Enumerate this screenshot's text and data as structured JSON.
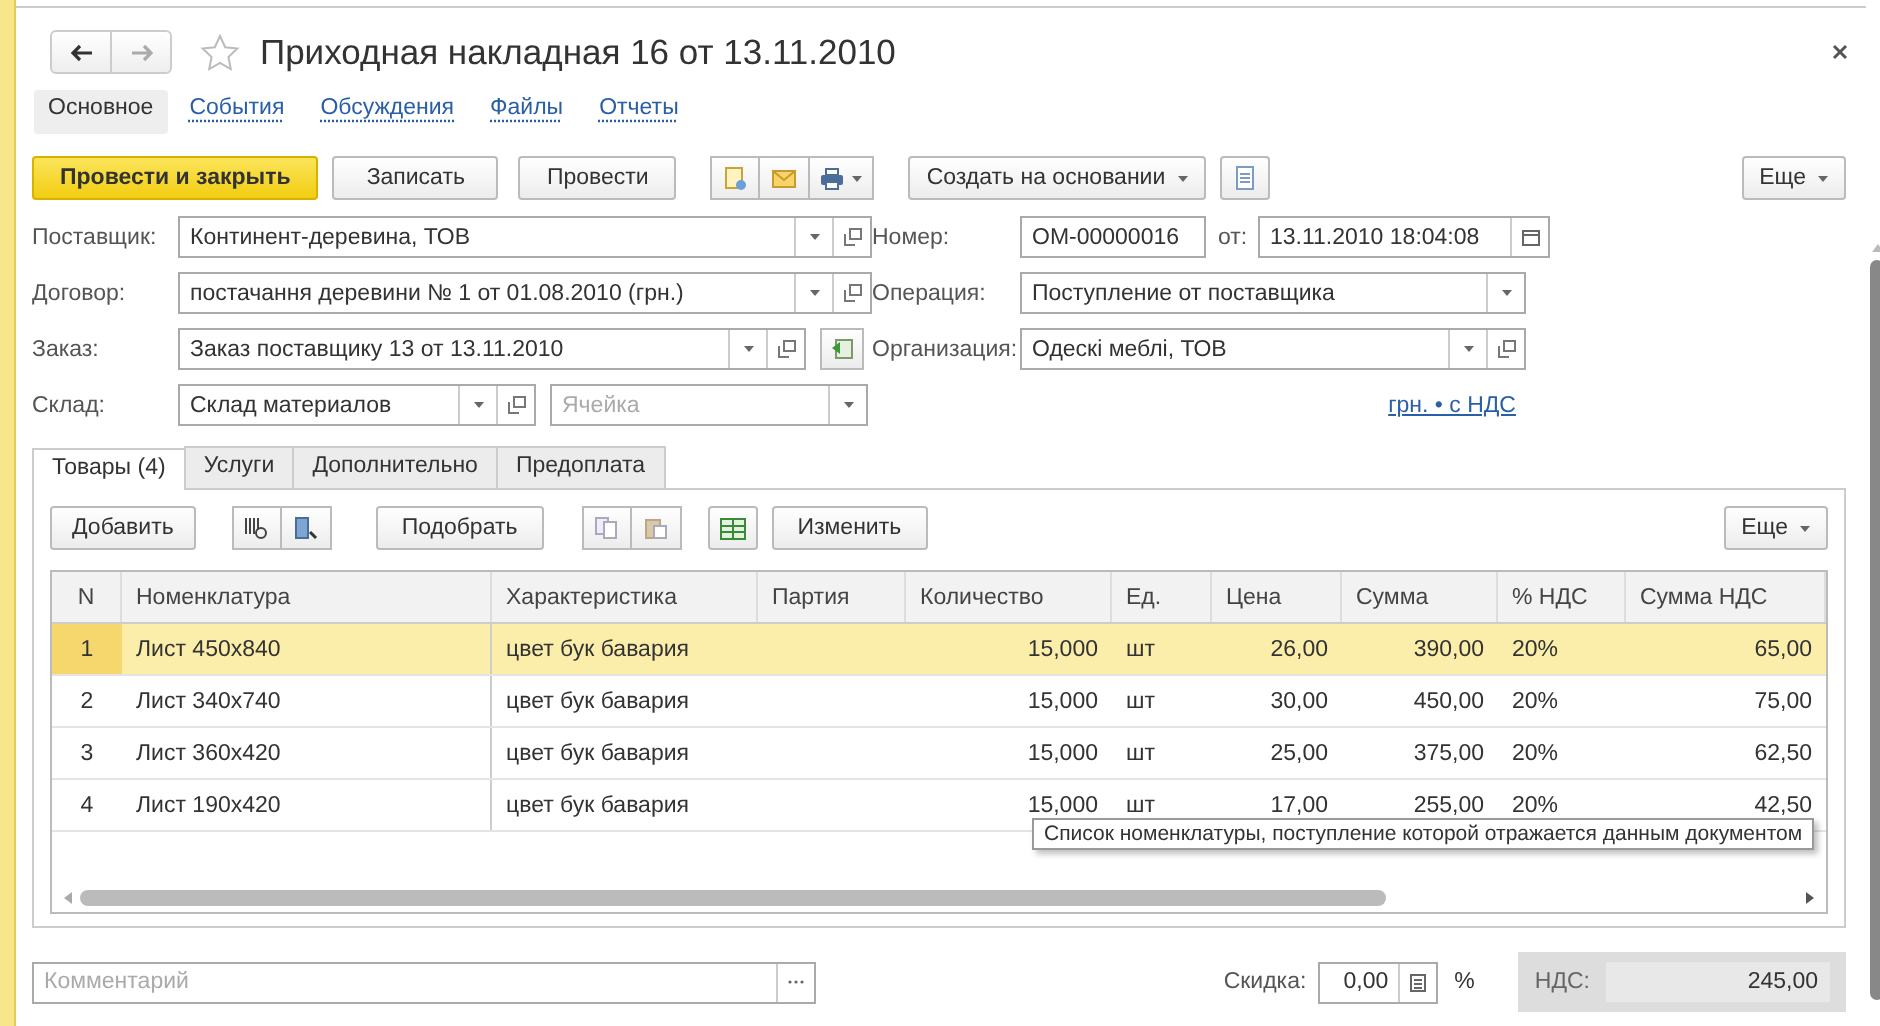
{
  "window": {
    "title": "Приходная накладная 16 от 13.11.2010",
    "favorite": false
  },
  "nav_tabs": [
    {
      "label": "Основное",
      "selected": true
    },
    {
      "label": "События",
      "selected": false
    },
    {
      "label": "Обсуждения",
      "selected": false
    },
    {
      "label": "Файлы",
      "selected": false
    },
    {
      "label": "Отчеты",
      "selected": false
    }
  ],
  "toolbar": {
    "post_and_close": "Провести и закрыть",
    "save": "Записать",
    "post": "Провести",
    "create_based_on": "Создать на основании",
    "more": "Еще"
  },
  "fields": {
    "supplier": {
      "label": "Поставщик:",
      "value": "Континент-деревина, ТОВ"
    },
    "contract": {
      "label": "Договор:",
      "value": "постачання деревини № 1 от 01.08.2010 (грн.)"
    },
    "order": {
      "label": "Заказ:",
      "value": "Заказ поставщику 13 от 13.11.2010"
    },
    "warehouse": {
      "label": "Склад:",
      "value": "Склад материалов"
    },
    "cell": {
      "placeholder": "Ячейка"
    },
    "number": {
      "label": "Номер:",
      "value": "ОМ-00000016"
    },
    "date": {
      "label": "от:",
      "value": "13.11.2010 18:04:08"
    },
    "operation": {
      "label": "Операция:",
      "value": "Поступление от поставщика"
    },
    "organization": {
      "label": "Организация:",
      "value": "Одескі меблі, ТОВ"
    },
    "price_link": "грн. • с НДС"
  },
  "tabs": [
    {
      "label": "Товары (4)",
      "selected": true
    },
    {
      "label": "Услуги",
      "selected": false
    },
    {
      "label": "Дополнительно",
      "selected": false
    },
    {
      "label": "Предоплата",
      "selected": false
    }
  ],
  "table_toolbar": {
    "add": "Добавить",
    "pick": "Подобрать",
    "change": "Изменить",
    "more": "Еще"
  },
  "table": {
    "columns": [
      "N",
      "Номенклатура",
      "Характеристика",
      "Партия",
      "Количество",
      "Ед.",
      "Цена",
      "Сумма",
      "% НДС",
      "Сумма НДС"
    ],
    "rows": [
      {
        "selected": true,
        "cells": [
          "1",
          "Лист 450x840",
          "цвет бук бавария",
          "",
          "15,000",
          "шт",
          "26,00",
          "390,00",
          "20%",
          "65,00"
        ]
      },
      {
        "selected": false,
        "cells": [
          "2",
          "Лист 340x740",
          "цвет бук бавария",
          "",
          "15,000",
          "шт",
          "30,00",
          "450,00",
          "20%",
          "75,00"
        ]
      },
      {
        "selected": false,
        "cells": [
          "3",
          "Лист 360x420",
          "цвет бук бавария",
          "",
          "15,000",
          "шт",
          "25,00",
          "375,00",
          "20%",
          "62,50"
        ]
      },
      {
        "selected": false,
        "cells": [
          "4",
          "Лист 190x420",
          "цвет бук бавария",
          "",
          "15,000",
          "шт",
          "17,00",
          "255,00",
          "20%",
          "42,50"
        ]
      }
    ]
  },
  "tooltip": "Список номенклатуры, поступление которой отражается данным документом",
  "footer": {
    "comment": {
      "placeholder": "Комментарий"
    },
    "discount": {
      "label": "Скидка:",
      "value": "0,00",
      "unit": "%"
    },
    "vat": {
      "label": "НДС:",
      "value": "245,00"
    }
  }
}
